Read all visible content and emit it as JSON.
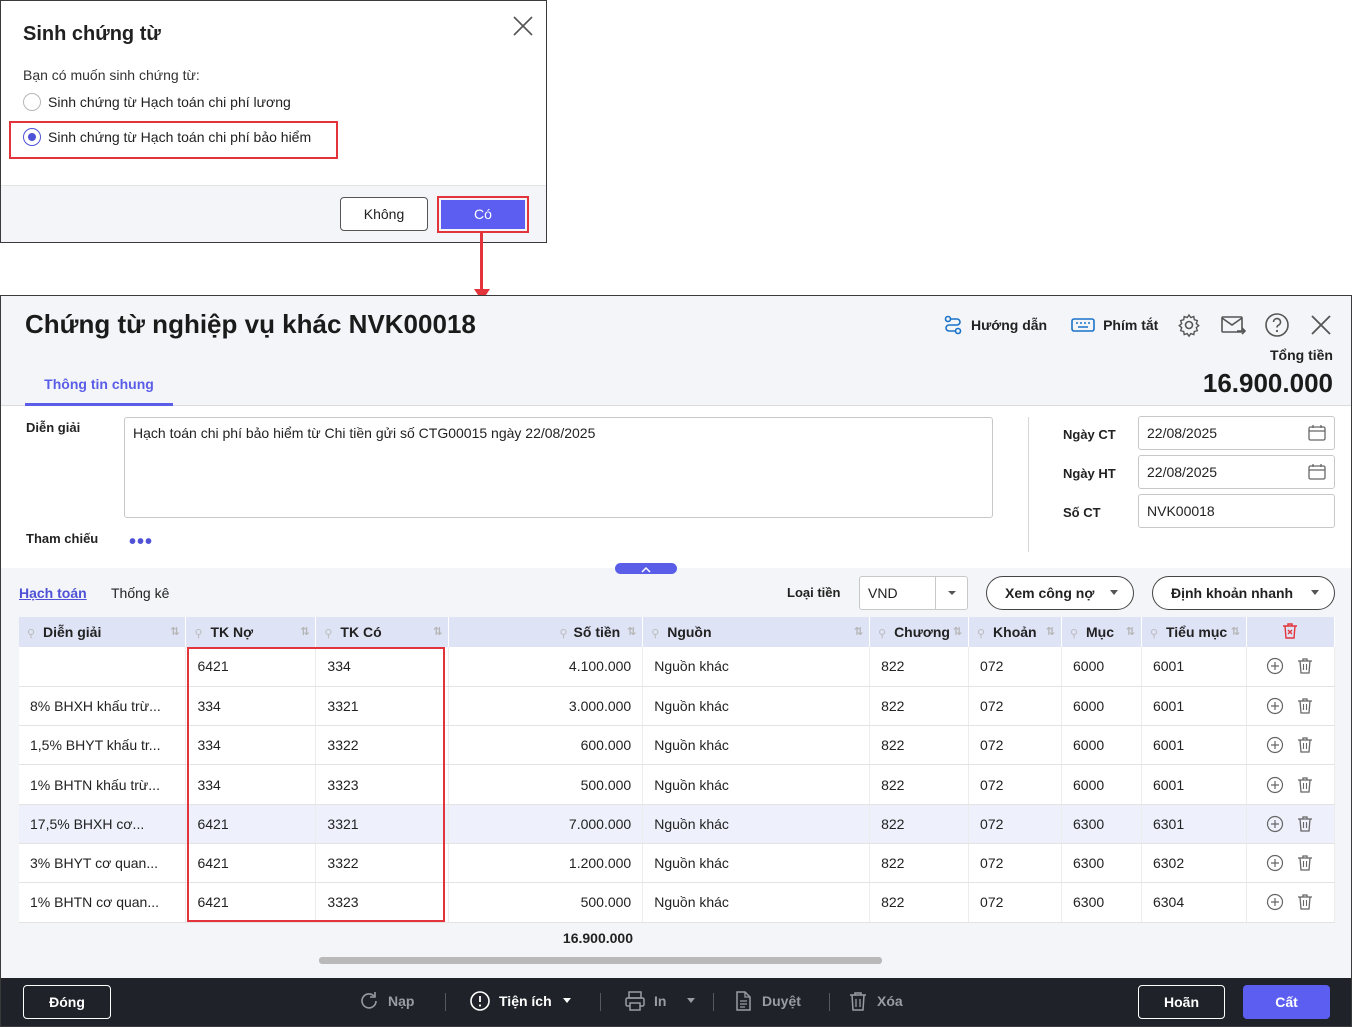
{
  "dialog": {
    "title": "Sinh chứng từ",
    "question": "Bạn có muốn sinh chứng từ:",
    "options": [
      {
        "label": "Sinh chứng từ Hạch toán chi phí lương",
        "checked": false
      },
      {
        "label": "Sinh chứng từ Hạch toán chi phí bảo hiểm",
        "checked": true
      }
    ],
    "no_label": "Không",
    "yes_label": "Có"
  },
  "window": {
    "title": "Chứng từ nghiệp vụ khác NVK00018",
    "guide_label": "Hướng dẫn",
    "shortcut_label": "Phím tắt",
    "total_label": "Tổng tiền",
    "total_value": "16.900.000",
    "tab_general": "Thông tin chung"
  },
  "form": {
    "desc_label": "Diễn giải",
    "desc_value": "Hạch toán chi phí bảo hiểm từ Chi tiền gửi số CTG00015 ngày 22/08/2025",
    "ref_label": "Tham chiếu",
    "ref_dots": "•••",
    "date_ct_label": "Ngày CT",
    "date_ct_value": "22/08/2025",
    "date_ht_label": "Ngày HT",
    "date_ht_value": "22/08/2025",
    "so_ct_label": "Số CT",
    "so_ct_value": "NVK00018"
  },
  "grid_toolbar": {
    "tab_hach_toan": "Hạch toán",
    "tab_thong_ke": "Thống kê",
    "currency_label": "Loại tiền",
    "currency_value": "VND",
    "debt_button": "Xem công nợ",
    "quick_button": "Định khoản nhanh"
  },
  "table": {
    "headers": [
      "Diễn giải",
      "TK Nợ",
      "TK Có",
      "Số tiền",
      "Nguồn",
      "Chương",
      "Khoản",
      "Mục",
      "Tiểu mục"
    ],
    "rows": [
      [
        "",
        "6421",
        "334",
        "4.100.000",
        "Nguồn khác",
        "822",
        "072",
        "6000",
        "6001"
      ],
      [
        "8% BHXH khấu trừ...",
        "334",
        "3321",
        "3.000.000",
        "Nguồn khác",
        "822",
        "072",
        "6000",
        "6001"
      ],
      [
        "1,5% BHYT khấu tr...",
        "334",
        "3322",
        "600.000",
        "Nguồn khác",
        "822",
        "072",
        "6000",
        "6001"
      ],
      [
        "1% BHTN khấu trừ...",
        "334",
        "3323",
        "500.000",
        "Nguồn khác",
        "822",
        "072",
        "6000",
        "6001"
      ],
      [
        "17,5% BHXH cơ...",
        "6421",
        "3321",
        "7.000.000",
        "Nguồn khác",
        "822",
        "072",
        "6300",
        "6301"
      ],
      [
        "3% BHYT cơ quan...",
        "6421",
        "3322",
        "1.200.000",
        "Nguồn khác",
        "822",
        "072",
        "6300",
        "6302"
      ],
      [
        "1% BHTN cơ quan...",
        "6421",
        "3323",
        "500.000",
        "Nguồn khác",
        "822",
        "072",
        "6300",
        "6304"
      ]
    ],
    "selected_row": 4,
    "sum_amount": "16.900.000"
  },
  "footer": {
    "close_label": "Đóng",
    "reload_label": "Nạp",
    "utility_label": "Tiện ích",
    "print_label": "In",
    "approve_label": "Duyệt",
    "delete_label": "Xóa",
    "cancel_label": "Hoãn",
    "save_label": "Cất"
  },
  "colors": {
    "accent": "#5b5ef0",
    "highlight": "#e2343a",
    "header_bg": "#f4f5f8",
    "footer_bg": "#1f2228"
  }
}
